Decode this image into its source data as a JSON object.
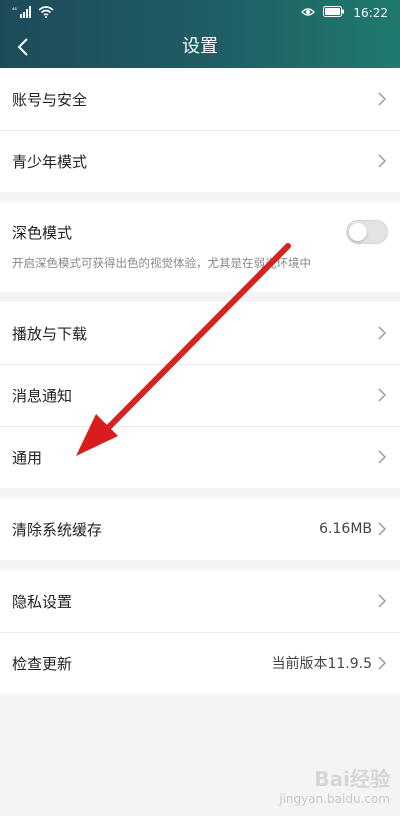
{
  "status_bar": {
    "signal": "⁴⁶",
    "time": "16:22"
  },
  "header": {
    "title": "设置"
  },
  "groups": {
    "account": {
      "items": [
        {
          "label": "账号与安全"
        },
        {
          "label": "青少年模式"
        }
      ]
    },
    "dark_mode": {
      "label": "深色模式",
      "description": "开启深色模式可获得出色的视觉体验，尤其是在弱光环境中",
      "enabled": false
    },
    "playback": {
      "items": [
        {
          "label": "播放与下载"
        },
        {
          "label": "消息通知"
        },
        {
          "label": "通用"
        }
      ]
    },
    "cache": {
      "label": "清除系统缓存",
      "value": "6.16MB"
    },
    "misc": {
      "items": [
        {
          "label": "隐私设置"
        },
        {
          "label": "检查更新",
          "value": "当前版本11.9.5"
        }
      ]
    }
  },
  "watermark": {
    "main": "Bai经验",
    "sub": "jingyan.baidu.com"
  },
  "colors": {
    "header_start": "#1d4b5a",
    "header_end": "#1f7a6e",
    "arrow": "#e02020",
    "background": "#f4f4f4"
  }
}
